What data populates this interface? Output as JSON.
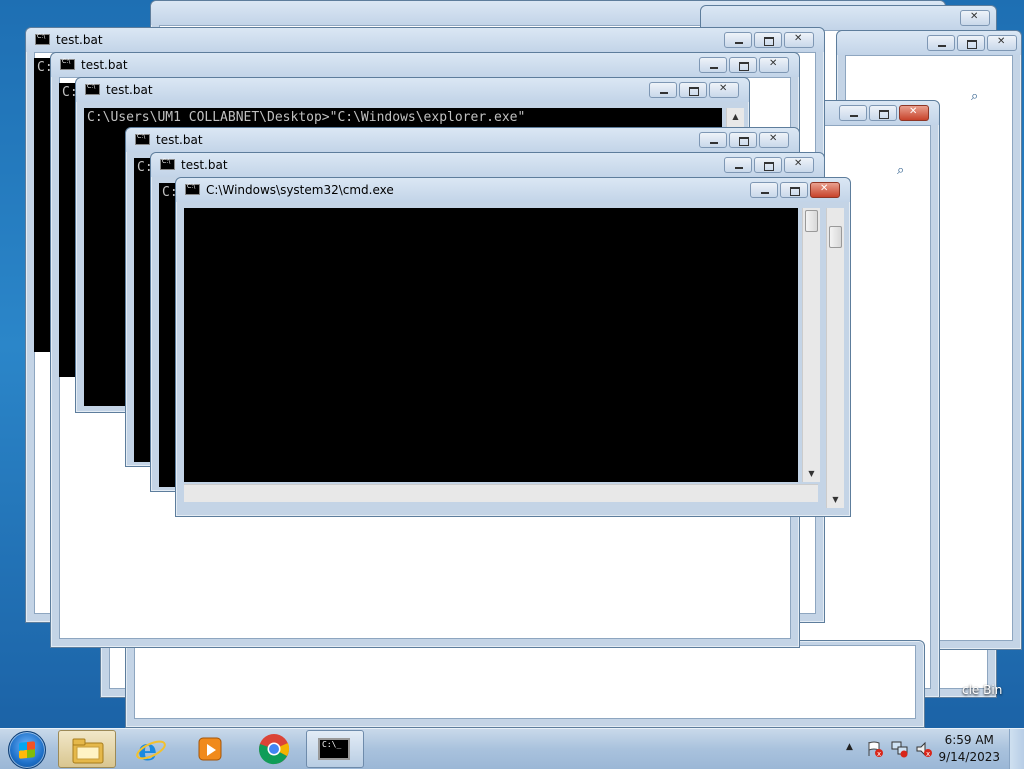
{
  "windows": [
    {
      "title": ""
    },
    {
      "title": ""
    },
    {
      "title": ""
    },
    {
      "title": "test.bat",
      "console_text": "C:"
    },
    {
      "title": "test.bat",
      "console_text": "C:"
    },
    {
      "title": "test.bat",
      "console_text": "C:\\Users\\UM1 COLLABNET\\Desktop>\"C:\\Windows\\explorer.exe\""
    },
    {
      "title": "test.bat",
      "console_text": "C:"
    },
    {
      "title": "test.bat",
      "console_text": "C:"
    },
    {
      "title": "C:\\Windows\\system32\\cmd.exe",
      "console_text": ""
    }
  ],
  "taskbar": {
    "items": [
      {
        "name": "Windows Explorer"
      },
      {
        "name": "Internet Explorer"
      },
      {
        "name": "Windows Media Player"
      },
      {
        "name": "Google Chrome"
      },
      {
        "name": "Command Prompt"
      }
    ],
    "clock": {
      "time": "6:59 AM",
      "date": "9/14/2023"
    },
    "tray_up_arrow": "▲"
  },
  "desktop": {
    "recycle_bin_label": "cle Bin"
  },
  "icons": {
    "start": "windows-start-icon",
    "search": "search-icon",
    "flag": "action-center-icon",
    "network": "network-icon",
    "volume": "volume-muted-icon"
  }
}
